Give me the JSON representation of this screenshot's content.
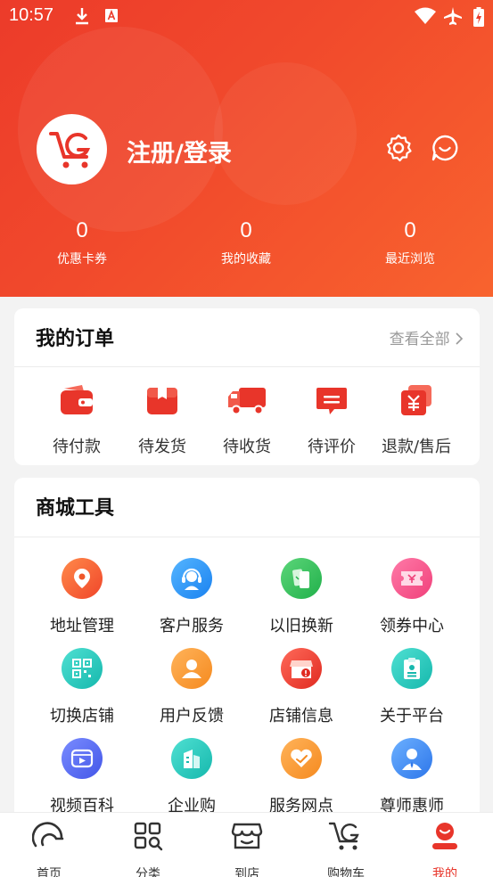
{
  "status_bar": {
    "time": "10:57"
  },
  "header": {
    "login_text": "注册/登录"
  },
  "stats": [
    {
      "value": "0",
      "label": "优惠卡券"
    },
    {
      "value": "0",
      "label": "我的收藏"
    },
    {
      "value": "0",
      "label": "最近浏览"
    }
  ],
  "orders": {
    "title": "我的订单",
    "view_all": "查看全部",
    "items": [
      {
        "label": "待付款",
        "icon": "wallet-icon"
      },
      {
        "label": "待发货",
        "icon": "package-icon"
      },
      {
        "label": "待收货",
        "icon": "truck-icon"
      },
      {
        "label": "待评价",
        "icon": "comment-icon"
      },
      {
        "label": "退款/售后",
        "icon": "refund-icon"
      }
    ]
  },
  "tools": {
    "title": "商城工具",
    "items": [
      {
        "label": "地址管理",
        "icon": "location-pin-icon"
      },
      {
        "label": "客户服务",
        "icon": "customer-service-icon"
      },
      {
        "label": "以旧换新",
        "icon": "trade-in-icon"
      },
      {
        "label": "领券中心",
        "icon": "coupon-icon"
      },
      {
        "label": "切换店铺",
        "icon": "qr-code-icon"
      },
      {
        "label": "用户反馈",
        "icon": "user-icon"
      },
      {
        "label": "店铺信息",
        "icon": "store-info-icon"
      },
      {
        "label": "关于平台",
        "icon": "id-badge-icon"
      },
      {
        "label": "视频百科",
        "icon": "video-icon"
      },
      {
        "label": "企业购",
        "icon": "building-icon"
      },
      {
        "label": "服务网点",
        "icon": "heart-hands-icon"
      },
      {
        "label": "尊师惠师",
        "icon": "teacher-icon"
      }
    ]
  },
  "tabbar": [
    {
      "label": "首页",
      "icon": "home-icon"
    },
    {
      "label": "分类",
      "icon": "category-icon"
    },
    {
      "label": "到店",
      "icon": "store-icon"
    },
    {
      "label": "购物车",
      "icon": "cart-icon"
    },
    {
      "label": "我的",
      "icon": "profile-icon"
    }
  ],
  "colors": {
    "accent": "#e8352a",
    "hero_start": "#ec3b2a",
    "hero_end": "#f8632e"
  }
}
